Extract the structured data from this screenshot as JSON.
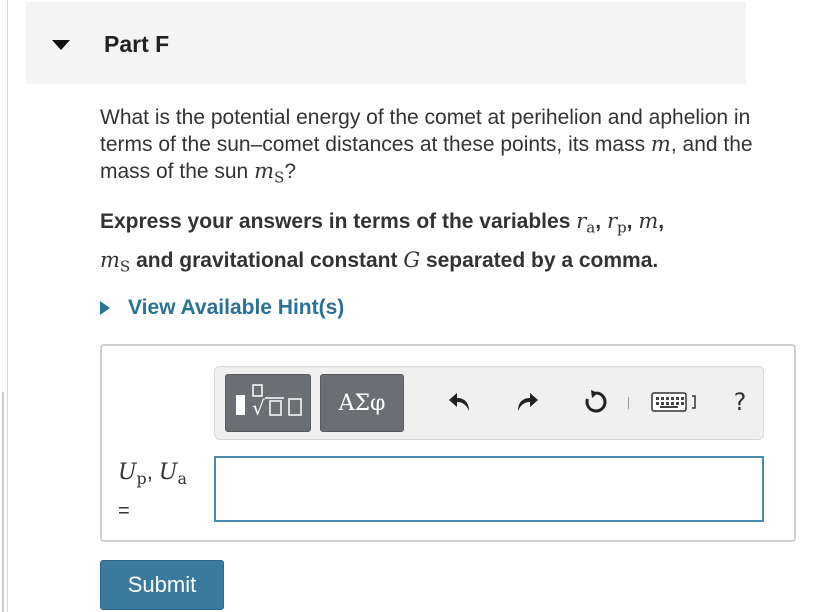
{
  "part": {
    "title": "Part F"
  },
  "question": {
    "line1": "What is the potential energy of the comet at perihelion and aphelion in terms of the sun–comet distances at these points, its mass ",
    "var_m": "m",
    "line2": ", and the mass of the sun ",
    "var_ms": "m",
    "var_ms_sub": "S",
    "end": "?"
  },
  "instruction": {
    "prefix": "Express your answers in terms of the variables ",
    "r_a": "r",
    "r_a_sub": "a",
    "r_p": "r",
    "r_p_sub": "p",
    "m": "m",
    "ms": "m",
    "ms_sub": "S",
    "middle": " and gravitational constant ",
    "G": "G",
    "suffix": " separated by a comma."
  },
  "hint": {
    "label": "View Available Hint(s)"
  },
  "toolbar": {
    "greek_label": "ΑΣφ",
    "help_label": "?"
  },
  "answer": {
    "u_p": "U",
    "u_p_sub": "p",
    "u_a": "U",
    "u_a_sub": "a",
    "equals": "=",
    "value": ""
  },
  "submit": {
    "label": "Submit"
  },
  "colors": {
    "accent_link": "#2a7196",
    "submit_bg": "#3a7a9c",
    "input_border": "#4a8ab0",
    "toolbar_button": "#6b6f73",
    "header_bg": "#f4f4f4"
  }
}
